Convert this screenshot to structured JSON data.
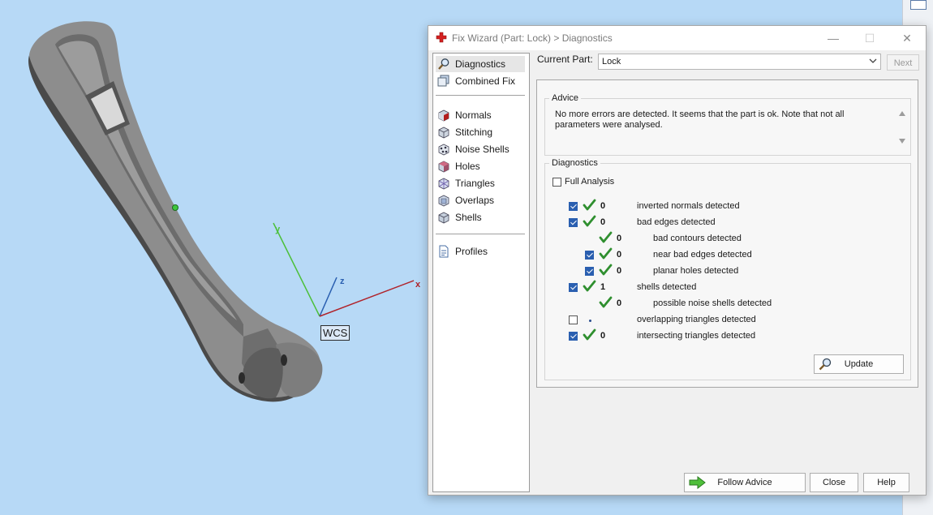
{
  "viewport": {
    "wcs_label": "WCS",
    "axes": {
      "x": "x",
      "y": "y",
      "z": "z"
    }
  },
  "dialog": {
    "title": "Fix Wizard (Part: Lock) > Diagnostics",
    "window_controls": {
      "minimize": "—",
      "maximize": "☐",
      "close": "✕"
    },
    "nav": {
      "items": [
        {
          "label": "Diagnostics",
          "icon": "magnifier-icon",
          "selected": true
        },
        {
          "label": "Combined Fix",
          "icon": "combined-fix-icon"
        },
        {
          "label": "Normals",
          "icon": "normals-cube-icon"
        },
        {
          "label": "Stitching",
          "icon": "stitching-cube-icon"
        },
        {
          "label": "Noise Shells",
          "icon": "noise-shells-icon"
        },
        {
          "label": "Holes",
          "icon": "holes-cube-icon"
        },
        {
          "label": "Triangles",
          "icon": "triangles-cube-icon"
        },
        {
          "label": "Overlaps",
          "icon": "overlaps-icon"
        },
        {
          "label": "Shells",
          "icon": "shells-cube-icon"
        },
        {
          "label": "Profiles",
          "icon": "profiles-document-icon"
        }
      ]
    },
    "current_part": {
      "label": "Current Part:",
      "value": "Lock"
    },
    "next_label": "Next",
    "advice": {
      "legend": "Advice",
      "text": "No more errors are detected. It seems that the part is ok. Note that not all parameters were analysed."
    },
    "diagnostics": {
      "legend": "Diagnostics",
      "full_analysis_label": "Full Analysis",
      "rows": [
        {
          "count": "0",
          "label": "inverted normals detected",
          "checked": true
        },
        {
          "count": "0",
          "label": "bad edges detected",
          "checked": true
        },
        {
          "count": "0",
          "label": "bad contours detected"
        },
        {
          "count": "0",
          "label": "near bad edges detected",
          "checked": true
        },
        {
          "count": "0",
          "label": "planar holes detected",
          "checked": true
        },
        {
          "count": "1",
          "label": "shells detected",
          "checked": true
        },
        {
          "count": "0",
          "label": "possible noise shells detected"
        },
        {
          "count": "",
          "label": "overlapping triangles detected",
          "checked": false
        },
        {
          "count": "0",
          "label": "intersecting triangles detected",
          "checked": true
        }
      ],
      "update_label": "Update"
    },
    "buttons": {
      "follow_advice": "Follow Advice",
      "close": "Close",
      "help": "Help"
    }
  },
  "colors": {
    "viewport_bg": "#b7d9f6",
    "check_green": "#2f8f2f",
    "checkbox_blue": "#2a5fb0",
    "x_axis": "#b0232a",
    "y_axis": "#4cbf3a",
    "z_axis": "#2a5fb0"
  }
}
